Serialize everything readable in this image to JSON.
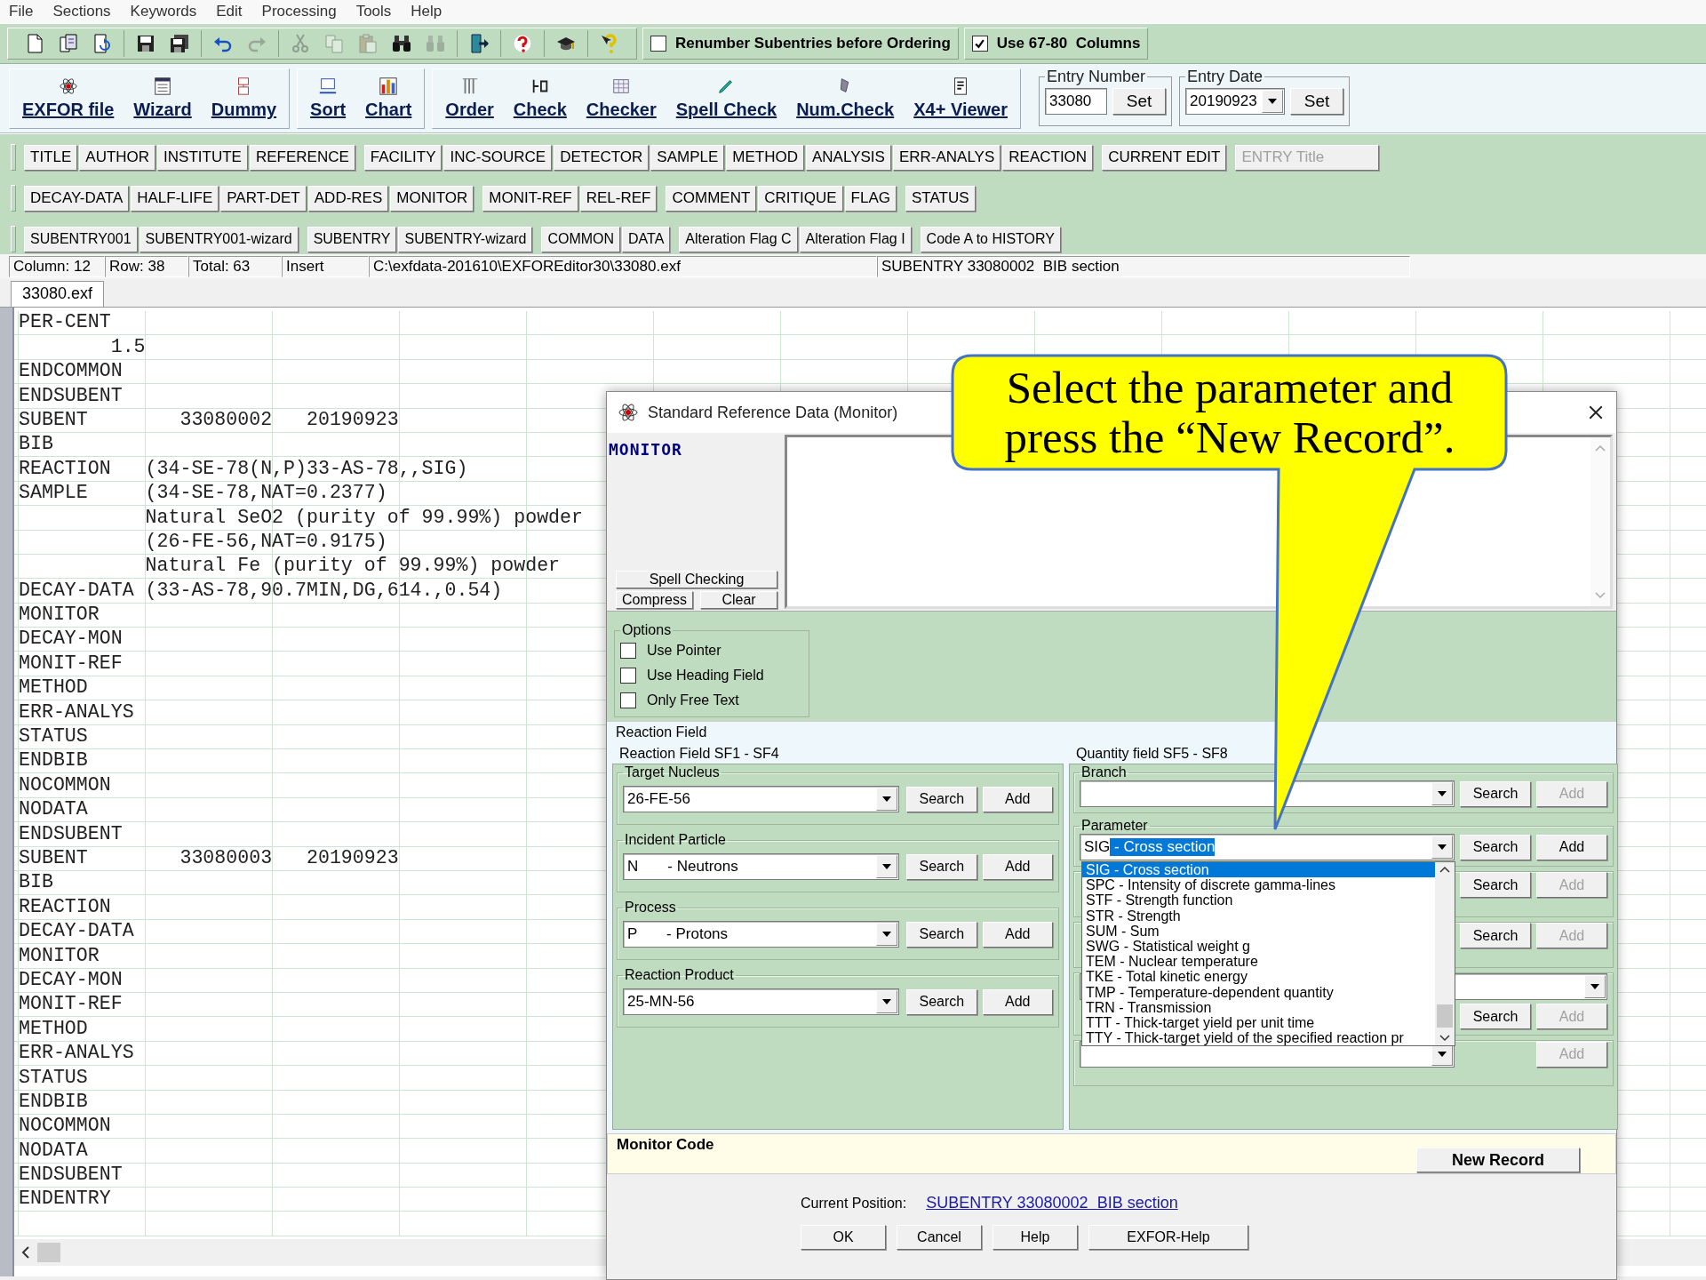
{
  "menu": [
    "File",
    "Sections",
    "Keywords",
    "Edit",
    "Processing",
    "Tools",
    "Help"
  ],
  "toolbar": {
    "icon_groups": [
      [
        {
          "kind": "new",
          "disabled": false
        },
        {
          "kind": "open",
          "disabled": false
        },
        {
          "kind": "reload",
          "disabled": false
        }
      ],
      [
        {
          "kind": "save",
          "disabled": false
        },
        {
          "kind": "save_all",
          "disabled": false
        }
      ],
      [
        {
          "kind": "undo",
          "disabled": false
        },
        {
          "kind": "redo",
          "disabled": true
        }
      ],
      [
        {
          "kind": "cut",
          "disabled": true
        },
        {
          "kind": "copy",
          "disabled": true
        },
        {
          "kind": "paste",
          "disabled": true
        },
        {
          "kind": "find",
          "disabled": false
        },
        {
          "kind": "find_next",
          "disabled": true
        }
      ],
      [
        {
          "kind": "exit",
          "disabled": false
        }
      ],
      [
        {
          "kind": "help",
          "disabled": false
        }
      ],
      [
        {
          "kind": "tutorial",
          "disabled": false
        }
      ],
      [
        {
          "kind": "context_help",
          "disabled": false
        }
      ]
    ],
    "checks": [
      {
        "label": "Renumber Subentries before Ordering",
        "checked": false
      },
      {
        "label": "Use 67-80  Columns",
        "checked": true
      }
    ]
  },
  "commands": [
    [
      {
        "kind": "exfor",
        "label": "EXFOR file"
      },
      {
        "kind": "wizard",
        "label": "Wizard"
      },
      {
        "kind": "dummy",
        "label": "Dummy"
      }
    ],
    [
      {
        "kind": "sort",
        "label": "Sort"
      },
      {
        "kind": "chart",
        "label": "Chart"
      }
    ],
    [
      {
        "kind": "order",
        "label": "Order"
      },
      {
        "kind": "check",
        "label": "Check"
      },
      {
        "kind": "checker",
        "label": "Checker"
      },
      {
        "kind": "spell",
        "label": "Spell Check"
      },
      {
        "kind": "num",
        "label": "Num.Check"
      },
      {
        "kind": "viewer",
        "label": "X4+ Viewer"
      }
    ]
  ],
  "entry_number": {
    "label": "Entry Number",
    "value": "33080",
    "button": "Set"
  },
  "entry_date": {
    "label": "Entry Date",
    "value": "20190923",
    "button": "Set"
  },
  "sections": [
    [
      [
        {
          "label": "TITLE",
          "disabled": false
        },
        {
          "label": "AUTHOR",
          "disabled": false
        },
        {
          "label": "INSTITUTE",
          "disabled": false
        },
        {
          "label": "REFERENCE",
          "disabled": false
        }
      ],
      [
        {
          "label": "FACILITY",
          "disabled": false
        },
        {
          "label": "INC-SOURCE",
          "disabled": false
        },
        {
          "label": "DETECTOR",
          "disabled": false
        },
        {
          "label": "SAMPLE",
          "disabled": false
        },
        {
          "label": "METHOD",
          "disabled": false
        },
        {
          "label": "ANALYSIS",
          "disabled": false
        },
        {
          "label": "ERR-ANALYS",
          "disabled": false
        },
        {
          "label": "REACTION",
          "disabled": false
        }
      ],
      [
        {
          "label": "CURRENT EDIT",
          "disabled": false
        }
      ],
      [
        {
          "label": "ENTRY Title",
          "disabled": true
        }
      ]
    ],
    [
      [
        {
          "label": "DECAY-DATA",
          "disabled": false
        },
        {
          "label": "HALF-LIFE",
          "disabled": false
        },
        {
          "label": "PART-DET",
          "disabled": false
        },
        {
          "label": "ADD-RES",
          "disabled": false
        },
        {
          "label": "MONITOR",
          "disabled": false
        }
      ],
      [
        {
          "label": "MONIT-REF",
          "disabled": false
        },
        {
          "label": "REL-REF",
          "disabled": false
        }
      ],
      [
        {
          "label": "COMMENT",
          "disabled": false
        },
        {
          "label": "CRITIQUE",
          "disabled": false
        },
        {
          "label": "FLAG",
          "disabled": false
        }
      ],
      [
        {
          "label": "STATUS",
          "disabled": false
        }
      ]
    ],
    [
      [
        {
          "label": "SUBENTRY001",
          "disabled": false
        },
        {
          "label": "SUBENTRY001-wizard",
          "disabled": false
        }
      ],
      [
        {
          "label": "SUBENTRY",
          "disabled": false
        },
        {
          "label": "SUBENTRY-wizard",
          "disabled": false
        }
      ],
      [
        {
          "label": "COMMON",
          "disabled": false
        },
        {
          "label": "DATA",
          "disabled": false
        }
      ],
      [
        {
          "label": "Alteration Flag C",
          "disabled": false
        },
        {
          "label": "Alteration Flag I",
          "disabled": false
        }
      ],
      [
        {
          "label": "Code A to HISTORY",
          "disabled": false
        }
      ]
    ]
  ],
  "status_bar": [
    "Column: 12",
    "Row: 38",
    "Total: 63",
    "Insert",
    "C:\\exfdata-201610\\EXFOREditor30\\33080.exf",
    "SUBENTRY 33080002  BIB section"
  ],
  "file_tab": "33080.exf",
  "editor_lines": [
    "PER-CENT",
    "        1.5",
    "ENDCOMMON",
    "ENDSUBENT",
    "SUBENT        33080002   20190923",
    "BIB",
    "REACTION   (34-SE-78(N,P)33-AS-78,,SIG)",
    "SAMPLE     (34-SE-78,NAT=0.2377)",
    "           Natural SeO2 (purity of 99.99%) powder",
    "           (26-FE-56,NAT=0.9175)",
    "           Natural Fe (purity of 99.99%) powder",
    "DECAY-DATA (33-AS-78,90.7MIN,DG,614.,0.54)",
    "MONITOR",
    "DECAY-MON",
    "MONIT-REF",
    "METHOD",
    "ERR-ANALYS",
    "STATUS",
    "ENDBIB",
    "NOCOMMON",
    "NODATA",
    "ENDSUBENT",
    "SUBENT        33080003   20190923",
    "BIB",
    "REACTION",
    "DECAY-DATA",
    "MONITOR",
    "DECAY-MON",
    "MONIT-REF",
    "METHOD",
    "ERR-ANALYS",
    "STATUS",
    "ENDBIB",
    "NOCOMMON",
    "NODATA",
    "ENDSUBENT",
    "ENDENTRY"
  ],
  "dialog": {
    "title": "Standard Reference Data (Monitor)",
    "heading": "MONITOR",
    "text_buttons": [
      "Spell Checking",
      "Compress",
      "Clear"
    ],
    "options": {
      "title": "Options",
      "items": [
        {
          "label": "Use Pointer",
          "checked": false
        },
        {
          "label": "Use Heading Field",
          "checked": false
        },
        {
          "label": "Only Free Text",
          "checked": false
        }
      ]
    },
    "reaction_field_title": "Reaction Field",
    "reaction_groups_title": "Reaction Field SF1 - SF4",
    "reaction_groups": [
      {
        "kind": "combo",
        "label": "Target Nucleus",
        "value": "26-FE-56",
        "search": "Search",
        "add": "Add",
        "add_disabled": false
      },
      {
        "kind": "combo",
        "label": "Incident Particle",
        "value": "N       - Neutrons",
        "search": "Search",
        "add": "Add",
        "add_disabled": false
      },
      {
        "kind": "combo",
        "label": "Process",
        "value": "P       - Protons",
        "search": "Search",
        "add": "Add",
        "add_disabled": false
      },
      {
        "kind": "combo",
        "label": "Reaction Product",
        "value": "25-MN-56",
        "search": "Search",
        "add": "Add",
        "add_disabled": false
      }
    ],
    "quantity_title": "Quantity field SF5 - SF8",
    "quantity_groups": [
      {
        "kind": "combo",
        "label": "Branch",
        "search": "Search",
        "add": "Add",
        "add_disabled": true
      },
      {
        "kind": "combo",
        "label": "Parameter",
        "value": "SIG",
        "selection": " - Cross section",
        "search": "Search",
        "add": "Add",
        "add_disabled": false,
        "options": [
          {
            "label": "SIG - Cross section",
            "selected": true
          },
          {
            "label": "SPC - Intensity of discrete gamma-lines",
            "selected": false
          },
          {
            "label": "STF - Strength function",
            "selected": false
          },
          {
            "label": "STR - Strength",
            "selected": false
          },
          {
            "label": "SUM - Sum",
            "selected": false
          },
          {
            "label": "SWG - Statistical weight g",
            "selected": false
          },
          {
            "label": "TEM - Nuclear temperature",
            "selected": false
          },
          {
            "label": "TKE - Total kinetic energy",
            "selected": false
          },
          {
            "label": "TMP - Temperature-dependent quantity",
            "selected": false
          },
          {
            "label": "TRN - Transmission",
            "selected": false
          },
          {
            "label": "TTT - Thick-target yield per unit time",
            "selected": false
          },
          {
            "label": "TTY - Thick-target yield of the specified reaction pr",
            "selected": false
          }
        ]
      },
      {
        "kind": "buttons",
        "search": "Search",
        "add": "Add",
        "add_disabled": true
      },
      {
        "kind": "buttons",
        "search": "Search",
        "add": "Add",
        "add_disabled": true
      },
      {
        "kind": "combo_stacked",
        "search": "Search",
        "add": "Add",
        "add_disabled": true
      },
      {
        "kind": "combo",
        "add": "Add",
        "add_disabled": true
      }
    ],
    "monitor_code": {
      "label": "Monitor Code",
      "button": "New Record"
    },
    "current_position": {
      "label": "Current Position:",
      "link": "SUBENTRY 33080002  BIB section"
    },
    "buttons": [
      "OK",
      "Cancel",
      "Help",
      "EXFOR-Help"
    ]
  },
  "callout": {
    "text": "Select the parameter and press the “New Record”."
  }
}
